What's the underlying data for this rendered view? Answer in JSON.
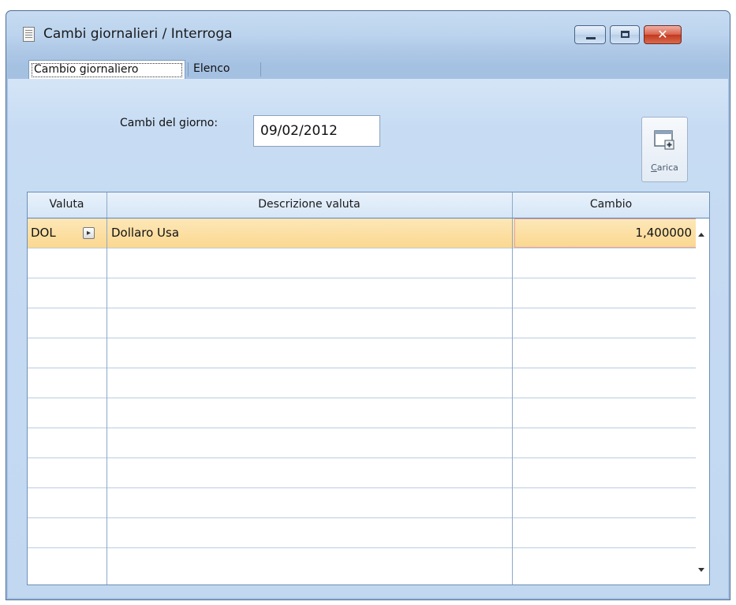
{
  "window": {
    "title": "Cambi giornalieri / Interroga",
    "close_glyph": "✕"
  },
  "tabs": [
    {
      "label": "Cambio giornaliero",
      "active": true
    },
    {
      "label": "Elenco",
      "active": false
    }
  ],
  "form": {
    "date_label": "Cambi del giorno:",
    "date_value": "09/02/2012",
    "load_button_label": "Carica"
  },
  "grid": {
    "columns": [
      "Valuta",
      "Descrizione valuta",
      "Cambio"
    ],
    "rows": [
      {
        "valuta": "DOL",
        "descrizione": "Dollaro Usa",
        "cambio": "1,400000",
        "selected": true
      }
    ]
  },
  "icons": {
    "app": "document-icon",
    "minimize": "minimize-icon",
    "maximize": "maximize-icon",
    "close": "close-icon",
    "zoom": "arrow-right-icon",
    "load": "window-add-icon"
  },
  "colors": {
    "selection": "#fbd890",
    "grid_border": "#6d8fb6",
    "close_button": "#c3381e"
  }
}
